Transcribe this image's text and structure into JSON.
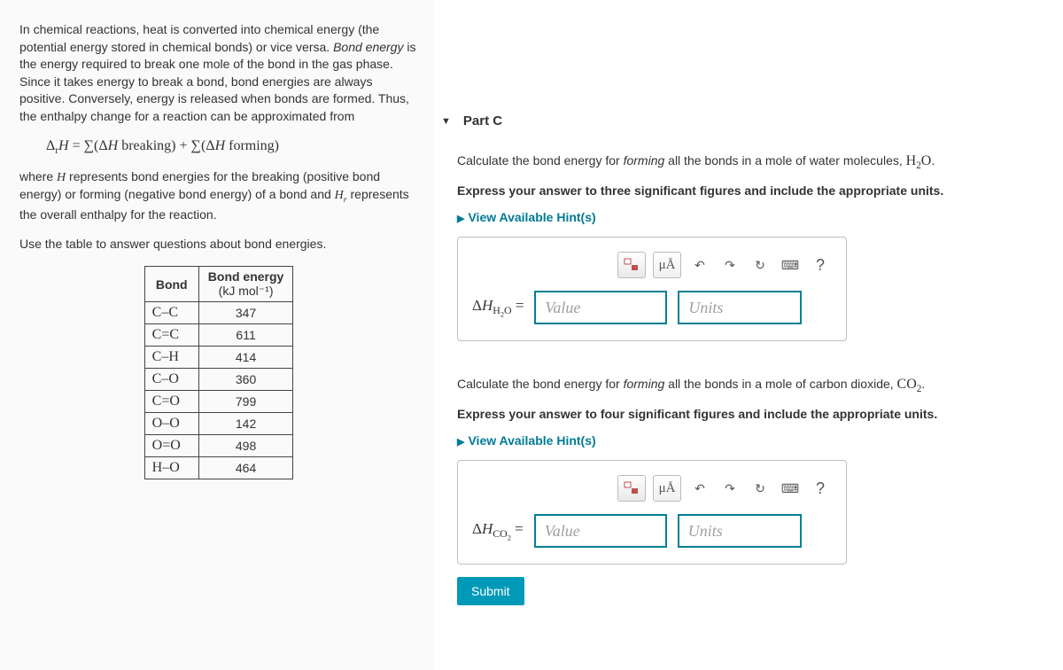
{
  "left": {
    "intro1": "In chemical reactions, heat is converted into chemical energy (the potential energy stored in chemical bonds) or vice versa. ",
    "intro1_em": "Bond energy",
    "intro1b": " is the energy required to break one mole of the bond in the gas phase. Since it takes energy to break a bond, bond energies are always positive. Conversely, energy is released when bonds are formed. Thus, the enthalpy change for a reaction can be approximated from",
    "formula": "Δ_r H = ∑(ΔH breaking) + ∑(ΔH forming)",
    "intro2a": "where ",
    "intro2_H": "H",
    "intro2b": " represents bond energies for the breaking (positive bond energy) or forming (negative bond energy) of a bond and ",
    "intro2_Hr": "H_r",
    "intro2c": " represents the overall enthalpy for the reaction.",
    "intro3": "Use the table to answer questions about bond energies.",
    "table": {
      "h1": "Bond",
      "h2a": "Bond energy",
      "h2b": "(kJ mol⁻¹)",
      "rows": [
        {
          "bond": "C–C",
          "val": "347"
        },
        {
          "bond": "C=C",
          "val": "611"
        },
        {
          "bond": "C–H",
          "val": "414"
        },
        {
          "bond": "C–O",
          "val": "360"
        },
        {
          "bond": "C=O",
          "val": "799"
        },
        {
          "bond": "O–O",
          "val": "142"
        },
        {
          "bond": "O=O",
          "val": "498"
        },
        {
          "bond": "H–O",
          "val": "464"
        }
      ]
    }
  },
  "right": {
    "part_label": "Part C",
    "q1": {
      "text1": "Calculate the bond energy for ",
      "em": "forming",
      "text2": " all the bonds in a mole of water molecules, ",
      "chem": "H₂O",
      "text3": ".",
      "instr": "Express your answer to three significant figures and include the appropriate units.",
      "hints": "View Available Hint(s)",
      "dh_label": "ΔH_H₂O =",
      "value_ph": "Value",
      "units_ph": "Units"
    },
    "q2": {
      "text1": "Calculate the bond energy for ",
      "em": "forming",
      "text2": " all the bonds in a mole of carbon dioxide, ",
      "chem": "CO₂",
      "text3": ".",
      "instr": "Express your answer to four significant figures and include the appropriate units.",
      "hints": "View Available Hint(s)",
      "dh_label": "ΔH_CO₂ =",
      "value_ph": "Value",
      "units_ph": "Units"
    },
    "toolbar": {
      "template": "▫▪",
      "muA": "μÅ",
      "undo": "↶",
      "redo": "↷",
      "reset": "↻",
      "keyboard": "⌨",
      "help": "?"
    },
    "submit": "Submit"
  }
}
